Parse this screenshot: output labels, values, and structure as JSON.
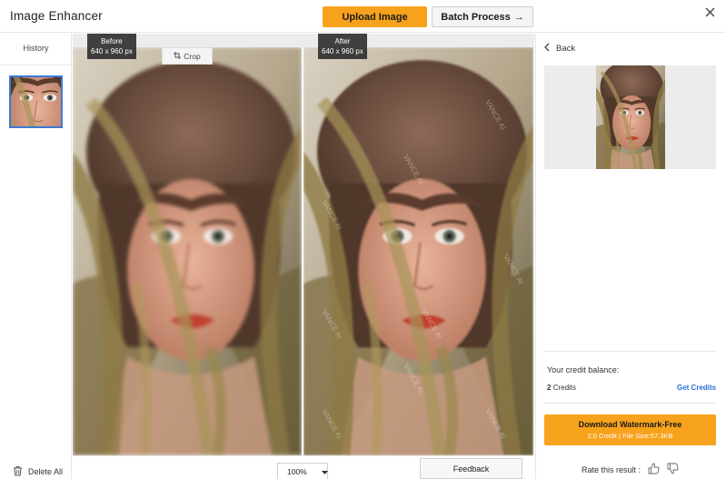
{
  "header": {
    "title": "Image Enhancer",
    "upload_label": "Upload Image",
    "batch_label": "Batch Process",
    "batch_arrow": "→"
  },
  "history": {
    "label": "History",
    "delete_label": "Delete All"
  },
  "compare": {
    "before_label": "Before",
    "before_size": "640 x 960 px",
    "after_label": "After",
    "after_size": "640 x 960 px",
    "crop_label": "Crop",
    "zoom_value": "100%",
    "feedback_label": "Feedback",
    "watermark_text": "VANCE AI"
  },
  "sidebar": {
    "back_label": "Back",
    "credit_balance_label": "Your credit balance:",
    "credits_count": "2",
    "credits_unit": "Credits",
    "get_credits_label": "Get Credits",
    "download_label": "Download Watermark-Free",
    "download_sub": "2.0 Credit | File Size:57.3KB",
    "rate_label": "Rate this result :"
  },
  "colors": {
    "accent": "#f7a21c",
    "selection": "#3a7bd5",
    "link": "#2a6fd6"
  }
}
